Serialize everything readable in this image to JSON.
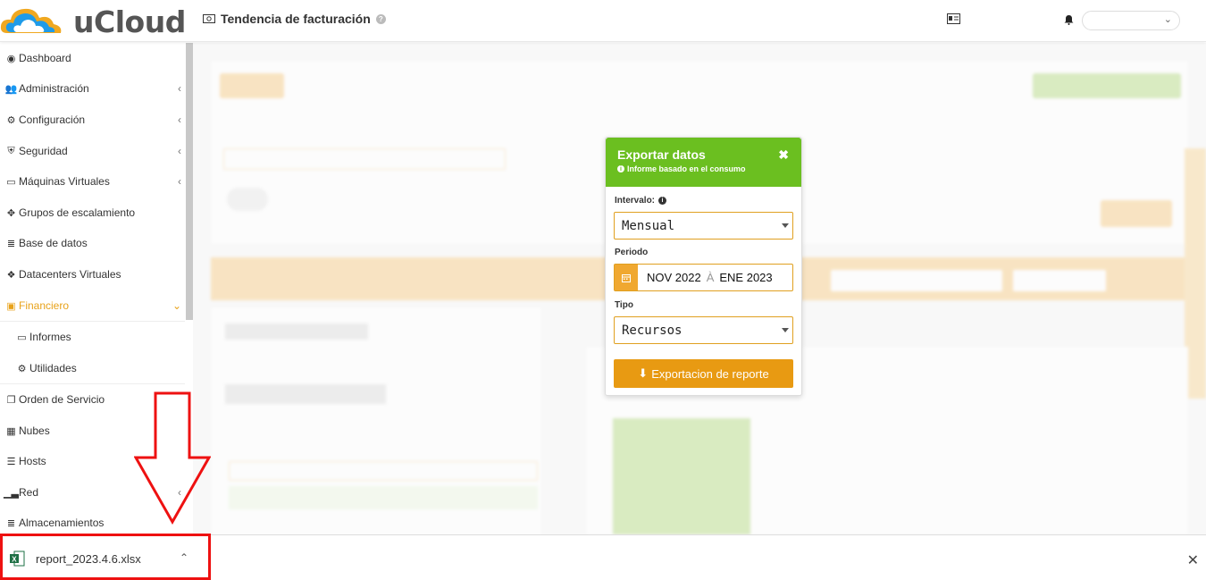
{
  "app": {
    "name": "uCloud"
  },
  "header": {
    "title": "Tendencia de facturación"
  },
  "sidebar": {
    "items": [
      {
        "label": "Dashboard",
        "icon": "dashboard-icon",
        "chevron": false
      },
      {
        "label": "Administración",
        "icon": "users-icon",
        "chevron": true
      },
      {
        "label": "Configuración",
        "icon": "gear-icon",
        "chevron": true
      },
      {
        "label": "Seguridad",
        "icon": "shield-icon",
        "chevron": true
      },
      {
        "label": "Máquinas Virtuales",
        "icon": "monitor-icon",
        "chevron": true
      },
      {
        "label": "Grupos de escalamiento",
        "icon": "arrows-icon",
        "chevron": false
      },
      {
        "label": "Base de datos",
        "icon": "database-icon",
        "chevron": false
      },
      {
        "label": "Datacenters Virtuales",
        "icon": "cubes-icon",
        "chevron": false
      },
      {
        "label": "Financiero",
        "icon": "money-icon",
        "chevron": true,
        "active": true
      },
      {
        "label": "Informes",
        "icon": "monitor-icon",
        "chevron": false,
        "sub": true
      },
      {
        "label": "Utilidades",
        "icon": "cogs-icon",
        "chevron": false,
        "sub": true
      },
      {
        "label": "Orden de Servicio",
        "icon": "window-icon",
        "chevron": false
      },
      {
        "label": "Nubes",
        "icon": "grid-icon",
        "chevron": false
      },
      {
        "label": "Hosts",
        "icon": "server-icon",
        "chevron": false
      },
      {
        "label": "Red",
        "icon": "signal-icon",
        "chevron": true
      },
      {
        "label": "Almacenamientos",
        "icon": "database-icon",
        "chevron": false
      }
    ]
  },
  "modal": {
    "title": "Exportar datos",
    "subtitle": "Informe basado en el consumo",
    "interval_label": "Intervalo:",
    "interval_value": "Mensual",
    "period_label": "Periodo",
    "period_from": "NOV 2022",
    "period_sep": "À",
    "period_to": "ENE 2023",
    "type_label": "Tipo",
    "type_value": "Recursos",
    "export_label": "Exportacion de reporte"
  },
  "downloads": {
    "file_name": "report_2023.4.6.xlsx"
  },
  "colors": {
    "accent_orange": "#e89a12",
    "modal_green": "#6bbf20",
    "highlight_red": "#e11111"
  }
}
